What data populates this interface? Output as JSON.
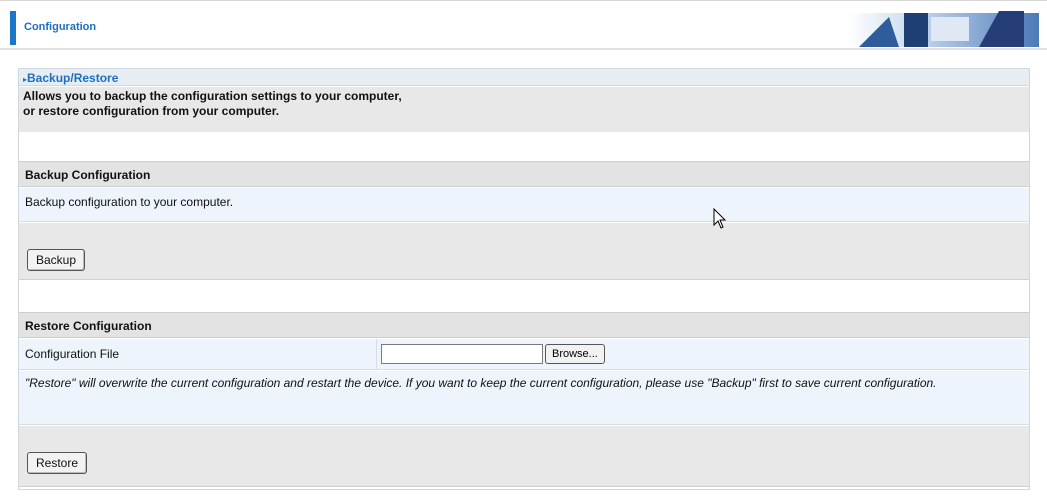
{
  "header": {
    "title": "Configuration"
  },
  "section": {
    "title": "Backup/Restore",
    "description_line1": "Allows you to backup the configuration settings to your computer,",
    "description_line2": "or restore configuration from your computer."
  },
  "backup": {
    "heading": "Backup Configuration",
    "text": "Backup configuration to your computer.",
    "button_label": "Backup"
  },
  "restore": {
    "heading": "Restore Configuration",
    "file_label": "Configuration File",
    "file_value": "",
    "browse_label": "Browse...",
    "warning": "\"Restore\" will overwrite the current configuration and restart the device. If you want to keep the current configuration, please use \"Backup\" first to save current configuration.",
    "button_label": "Restore"
  },
  "colors": {
    "accent": "#1976c8",
    "title_text": "#1f6fc0"
  }
}
